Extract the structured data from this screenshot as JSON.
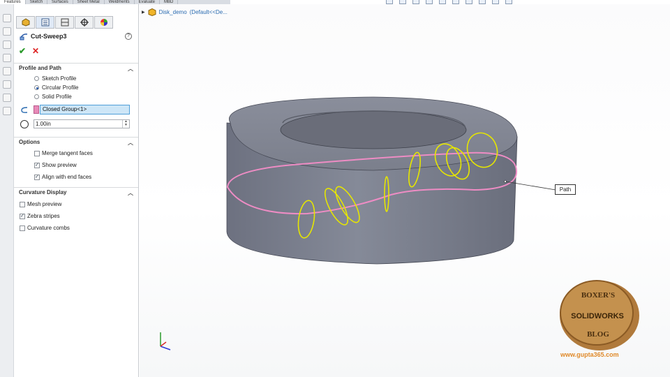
{
  "command_tabs": [
    "Features",
    "Sketch",
    "Surfaces",
    "Sheet Metal",
    "Weldments",
    "Evaluate",
    "MBD"
  ],
  "property_manager": {
    "tabs": [
      "feature-manager-icon",
      "property-manager-icon",
      "config-manager-icon",
      "dimxpert-icon",
      "display-manager-icon"
    ],
    "feature_name": "Cut-Sweep3",
    "help_glyph": "?",
    "ok_glyph": "✔",
    "cancel_glyph": "✕",
    "profile_and_path": {
      "title": "Profile and Path",
      "options": [
        {
          "label": "Sketch Profile",
          "selected": false
        },
        {
          "label": "Circular Profile",
          "selected": true
        },
        {
          "label": "Solid Profile",
          "selected": false
        }
      ],
      "path_selection": "Closed Group<1>",
      "diameter": "1.00in"
    },
    "options": {
      "title": "Options",
      "items": [
        {
          "label": "Merge tangent faces",
          "checked": false
        },
        {
          "label": "Show preview",
          "checked": true
        },
        {
          "label": "Align with end faces",
          "checked": true
        }
      ]
    },
    "curvature_display": {
      "title": "Curvature Display",
      "items": [
        {
          "label": "Mesh preview",
          "checked": false
        },
        {
          "label": "Zebra stripes",
          "checked": true
        },
        {
          "label": "Curvature combs",
          "checked": false
        }
      ]
    }
  },
  "viewport": {
    "tree_root": "Disk_demo",
    "tree_config": "(Default<<De...",
    "path_callout": "Path",
    "colors": {
      "path": "#ee8cc4",
      "profiles": "#e6e600",
      "body": "#7b7f8c"
    }
  },
  "watermark": {
    "top_text": "BOXER'S",
    "middle_text": "SOLIDWORKS",
    "bottom_text": "BLOG",
    "url": "www.gupta365.com"
  }
}
